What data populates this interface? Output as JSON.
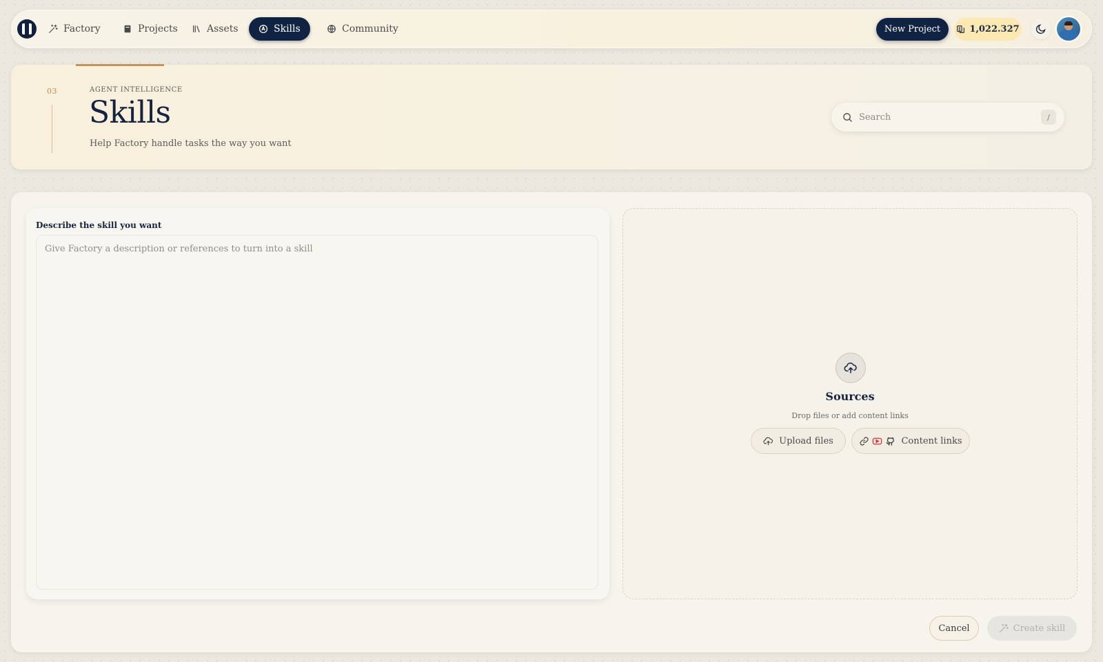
{
  "nav": {
    "items": [
      {
        "label": "Factory",
        "icon": "magic-wand-icon"
      },
      {
        "label": "Projects",
        "icon": "folder-icon"
      },
      {
        "label": "Assets",
        "icon": "library-icon"
      },
      {
        "label": "Skills",
        "icon": "skill-icon",
        "active": true
      },
      {
        "label": "Community",
        "icon": "globe-icon"
      }
    ],
    "new_project_label": "New Project",
    "credits": "1,022.327"
  },
  "header": {
    "step": "03",
    "eyebrow": "AGENT INTELLIGENCE",
    "title": "Skills",
    "subtitle": "Help Factory handle tasks the way you want",
    "search_placeholder": "Search",
    "search_shortcut": "/"
  },
  "describe": {
    "label": "Describe the skill you want",
    "placeholder": "Give Factory a description or references to turn into a skill"
  },
  "sources": {
    "title": "Sources",
    "subtitle": "Drop files or add content links",
    "upload_label": "Upload files",
    "links_label": "Content links"
  },
  "actions": {
    "cancel_label": "Cancel",
    "create_label": "Create skill"
  },
  "colors": {
    "accent": "#112343",
    "credits_bg": "#fbe8b2",
    "header_accent": "#c2945e",
    "youtube": "#e0323e"
  }
}
